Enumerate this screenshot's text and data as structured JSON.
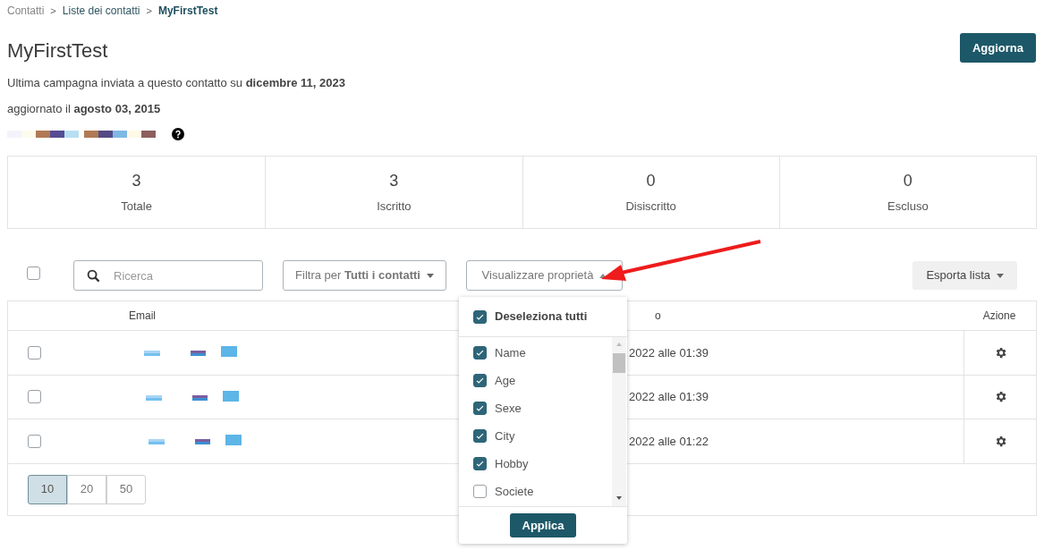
{
  "breadcrumb": [
    {
      "label": "Contatti",
      "current": false
    },
    {
      "label": "Liste dei contatti",
      "current": false
    },
    {
      "label": "MyFirstTest",
      "current": true
    }
  ],
  "breadcrumb_separator": ">",
  "title": "MyFirstTest",
  "update_button": "Aggiorna",
  "info_lines": [
    "Ultima campagna inviata a questo contatto su **dicembre 11, 2023**",
    "aggiornato il **agosto 03, 2015**"
  ],
  "stats": [
    {
      "value": "3",
      "label": "Totale"
    },
    {
      "value": "3",
      "label": "Iscritto"
    },
    {
      "value": "0",
      "label": "Disiscritto"
    },
    {
      "value": "0",
      "label": "Escluso"
    }
  ],
  "toolbar": {
    "select_all_checked": false,
    "search": {
      "placeholder": "Ricerca"
    },
    "filter": "Filtra per **Tutti i contatti**",
    "properties_button": "Visualizzare proprietà",
    "export_button": "Esporta lista"
  },
  "table": {
    "columns": [
      {
        "label": "Email"
      },
      {
        "label": "o"
      },
      {
        "label": "Azione"
      }
    ],
    "rows": [
      {
        "checked": false,
        "column_3": "2022 alle 01:39"
      },
      {
        "checked": false,
        "column_3": "2022 alle 01:39"
      },
      {
        "checked": false,
        "column_3": "2022 alle 01:22"
      }
    ]
  },
  "page_sizes": [
    {
      "label": "10",
      "selected": true
    },
    {
      "label": "20",
      "selected": false
    },
    {
      "label": "50",
      "selected": false
    }
  ],
  "properties_menu": {
    "toggle_all": {
      "label": "Deseleziona tutti",
      "checked": true
    },
    "items": [
      {
        "label": "Name",
        "checked": true
      },
      {
        "label": "Age",
        "checked": true
      },
      {
        "label": "Sexe",
        "checked": true
      },
      {
        "label": "City",
        "checked": true
      },
      {
        "label": "Hobby",
        "checked": true
      },
      {
        "label": "Societe",
        "checked": false
      }
    ],
    "apply_button": "Applica"
  }
}
